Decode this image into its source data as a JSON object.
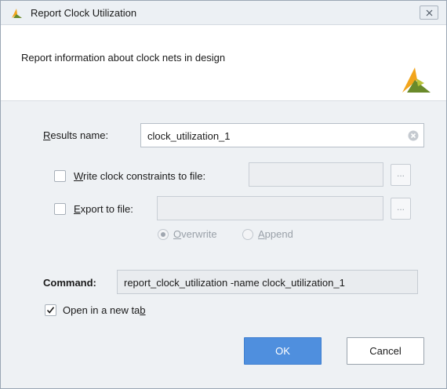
{
  "window": {
    "title": "Report Clock Utilization",
    "logo_icon": "xilinx-logo-icon",
    "close_icon": "close-icon"
  },
  "header": {
    "description": "Report information about clock nets in design",
    "logo_icon": "xilinx-logo-icon"
  },
  "results_name": {
    "label_mnemonic": "R",
    "label_rest": "esults name:",
    "value": "clock_utilization_1",
    "clear_icon": "clear-icon"
  },
  "write_constraints": {
    "checked": false,
    "label_mnemonic": "W",
    "label_rest": "rite clock constraints to file:",
    "value": "",
    "browse_label": "..."
  },
  "export_file": {
    "checked": false,
    "label_mnemonic": "E",
    "label_rest": "xport to file:",
    "value": "",
    "browse_label": "..."
  },
  "write_mode": {
    "options": [
      {
        "mnemonic": "O",
        "rest": "verwrite",
        "selected": true
      },
      {
        "mnemonic": "A",
        "rest": "ppend",
        "selected": false
      }
    ]
  },
  "command": {
    "label": "Command:",
    "value": "report_clock_utilization -name clock_utilization_1"
  },
  "open_new_tab": {
    "checked": true,
    "label_before": "Open in a new ta",
    "label_mnemonic": "b"
  },
  "buttons": {
    "ok_label": "OK",
    "cancel_label": "Cancel"
  },
  "colors": {
    "accent": "#4f8fde",
    "logo_gold": "#f2a51c",
    "logo_green": "#6a8a2a"
  }
}
